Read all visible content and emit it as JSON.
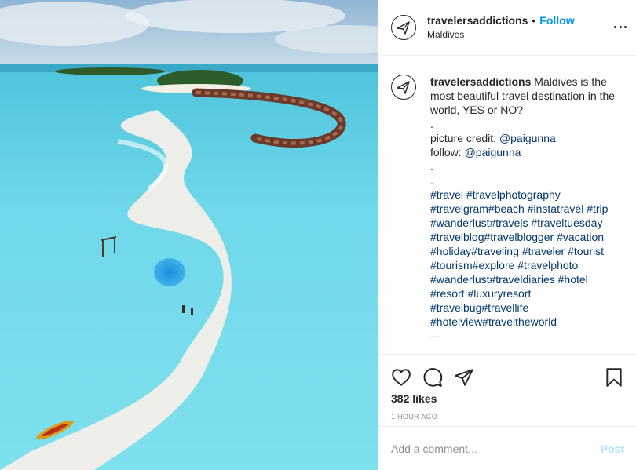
{
  "colors": {
    "link_blue": "#0095f6",
    "hashtag": "#00376b",
    "muted": "#8e8e8e"
  },
  "photo": {
    "subject": "Maldives island with overwater villas and sandbank"
  },
  "header": {
    "username": "travelersaddictions",
    "separator": "•",
    "follow_label": "Follow",
    "location": "Maldives",
    "avatar_icon": "airplane-icon",
    "more_icon": "more-options-icon"
  },
  "caption": {
    "username": "travelersaddictions",
    "text": "Maldives is the most beautiful travel destination in the world, YES or NO?",
    "lines": [
      ".",
      "picture credit: ",
      "follow: ",
      ".",
      ".",
      "."
    ],
    "credit_handle": "@paigunna",
    "follow_handle": "@paigunna",
    "hashtag_lines": [
      "#travel #travelphotography",
      "#travelgram#beach #instatravel #trip",
      "#wanderlust#travels #traveltuesday",
      "#travelblog#travelblogger #vacation",
      "#holiday#traveling #traveler #tourist",
      "#tourism#explore #travelphoto",
      "#wanderlust#traveldiaries #hotel",
      "#resort #luxuryresort",
      "#travelbug#travellife",
      "#hotelview#traveltheworld"
    ],
    "end": "---"
  },
  "actions": {
    "like_icon": "heart-icon",
    "comment_icon": "comment-icon",
    "share_icon": "paper-plane-icon",
    "save_icon": "bookmark-icon",
    "likes": "382 likes",
    "time": "1 HOUR AGO"
  },
  "comment": {
    "placeholder": "Add a comment...",
    "post_label": "Post"
  }
}
